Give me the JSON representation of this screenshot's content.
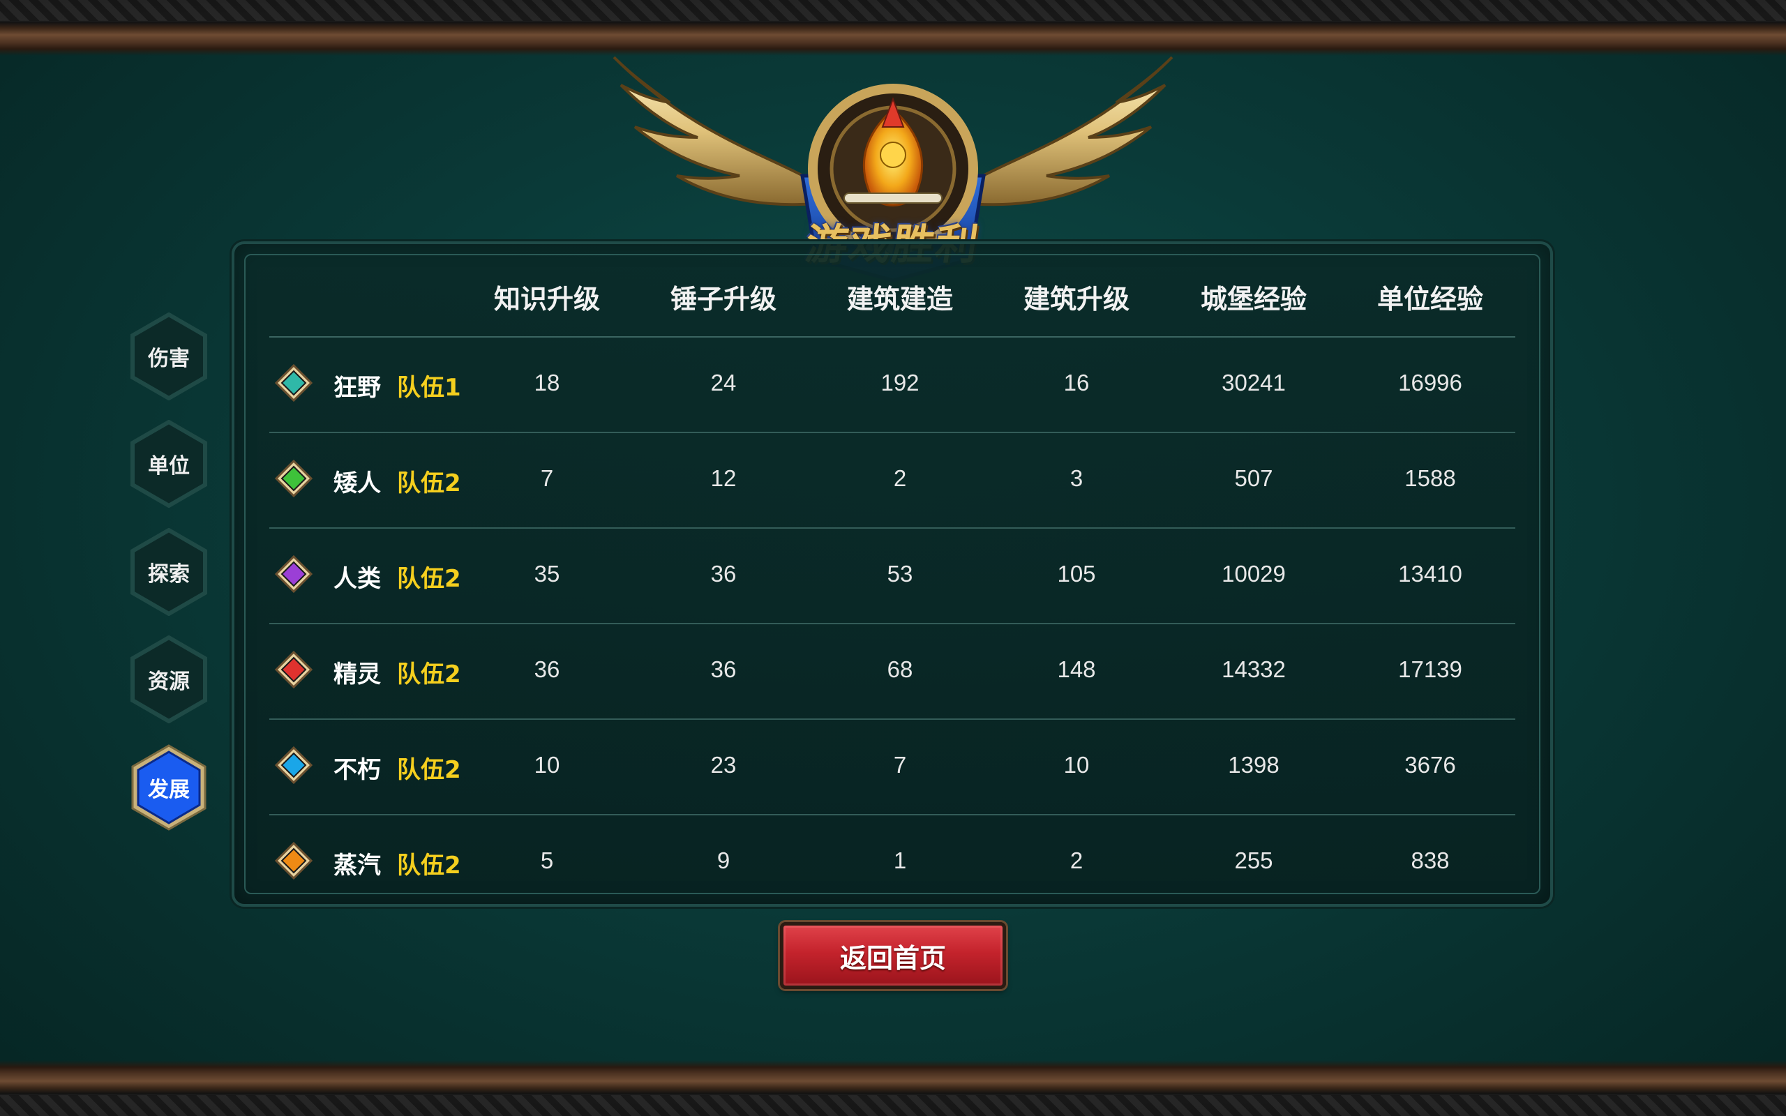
{
  "banner": {
    "title": "游戏胜利"
  },
  "tabs": [
    {
      "label": "伤害",
      "active": false
    },
    {
      "label": "单位",
      "active": false
    },
    {
      "label": "探索",
      "active": false
    },
    {
      "label": "资源",
      "active": false
    },
    {
      "label": "发展",
      "active": true
    }
  ],
  "table": {
    "columns": [
      "知识升级",
      "锤子升级",
      "建筑建造",
      "建筑升级",
      "城堡经验",
      "单位经验"
    ],
    "rows": [
      {
        "faction": "狂野",
        "team": "队伍1",
        "gem_color": "#2fb8a8",
        "values": [
          "18",
          "24",
          "192",
          "16",
          "30241",
          "16996"
        ]
      },
      {
        "faction": "矮人",
        "team": "队伍2",
        "gem_color": "#3ec23a",
        "values": [
          "7",
          "12",
          "2",
          "3",
          "507",
          "1588"
        ]
      },
      {
        "faction": "人类",
        "team": "队伍2",
        "gem_color": "#9b3fd6",
        "values": [
          "35",
          "36",
          "53",
          "105",
          "10029",
          "13410"
        ]
      },
      {
        "faction": "精灵",
        "team": "队伍2",
        "gem_color": "#e0322e",
        "values": [
          "36",
          "36",
          "68",
          "148",
          "14332",
          "17139"
        ]
      },
      {
        "faction": "不朽",
        "team": "队伍2",
        "gem_color": "#1aa6e8",
        "values": [
          "10",
          "23",
          "7",
          "10",
          "1398",
          "3676"
        ]
      },
      {
        "faction": "蒸汽",
        "team": "队伍2",
        "gem_color": "#ee8a14",
        "values": [
          "5",
          "9",
          "1",
          "2",
          "255",
          "838"
        ]
      }
    ]
  },
  "return_button": {
    "label": "返回首页"
  },
  "colors": {
    "team_label": "#f5cf1e",
    "active_tab": "#1a5cf0",
    "return_button": "#c4232c"
  }
}
